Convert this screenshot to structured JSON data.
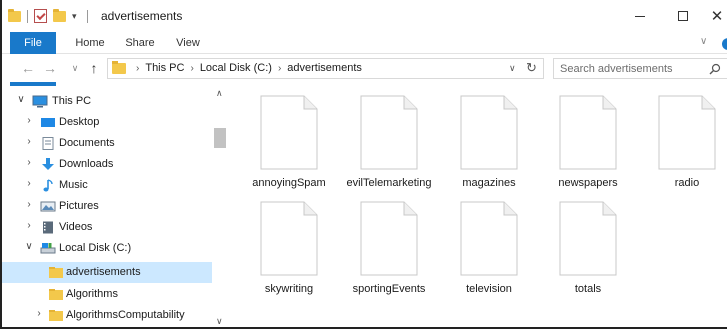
{
  "window": {
    "title": "advertisements",
    "controls": {
      "minimize": "minimize",
      "maximize": "maximize",
      "close": "✕"
    }
  },
  "ribbon": {
    "tabs": [
      {
        "label": "File",
        "active": true
      },
      {
        "label": "Home"
      },
      {
        "label": "Share"
      },
      {
        "label": "View"
      }
    ],
    "accent": "#1979ca"
  },
  "navigation": {
    "breadcrumbs": [
      "This PC",
      "Local Disk (C:)",
      "advertisements"
    ],
    "search_placeholder": "Search advertisements"
  },
  "tree": [
    {
      "label": "This PC",
      "icon": "pc-icon",
      "expanded": true,
      "level": 0
    },
    {
      "label": "Desktop",
      "icon": "desktop-icon",
      "level": 1
    },
    {
      "label": "Documents",
      "icon": "documents-icon",
      "level": 1
    },
    {
      "label": "Downloads",
      "icon": "downloads-icon",
      "level": 1
    },
    {
      "label": "Music",
      "icon": "music-icon",
      "level": 1
    },
    {
      "label": "Pictures",
      "icon": "pictures-icon",
      "level": 1
    },
    {
      "label": "Videos",
      "icon": "videos-icon",
      "level": 1
    },
    {
      "label": "Local Disk (C:)",
      "icon": "drive-icon",
      "expanded": true,
      "level": 1
    },
    {
      "label": "advertisements",
      "icon": "folder-icon",
      "level": 2,
      "selected": true
    },
    {
      "label": "Algorithms",
      "icon": "folder-icon",
      "level": 2
    },
    {
      "label": "AlgorithmsComputability",
      "icon": "folder-icon",
      "level": 2
    }
  ],
  "files": [
    {
      "name": "annoyingSpam",
      "icon": "document-icon"
    },
    {
      "name": "evilTelemarketing",
      "icon": "document-icon"
    },
    {
      "name": "magazines",
      "icon": "document-icon"
    },
    {
      "name": "newspapers",
      "icon": "document-icon"
    },
    {
      "name": "radio",
      "icon": "document-icon"
    },
    {
      "name": "skywriting",
      "icon": "document-icon"
    },
    {
      "name": "sportingEvents",
      "icon": "document-icon"
    },
    {
      "name": "television",
      "icon": "document-icon"
    },
    {
      "name": "totals",
      "icon": "document-icon"
    }
  ],
  "colors": {
    "selection": "#cce8ff",
    "folder": "#f3c84b"
  }
}
